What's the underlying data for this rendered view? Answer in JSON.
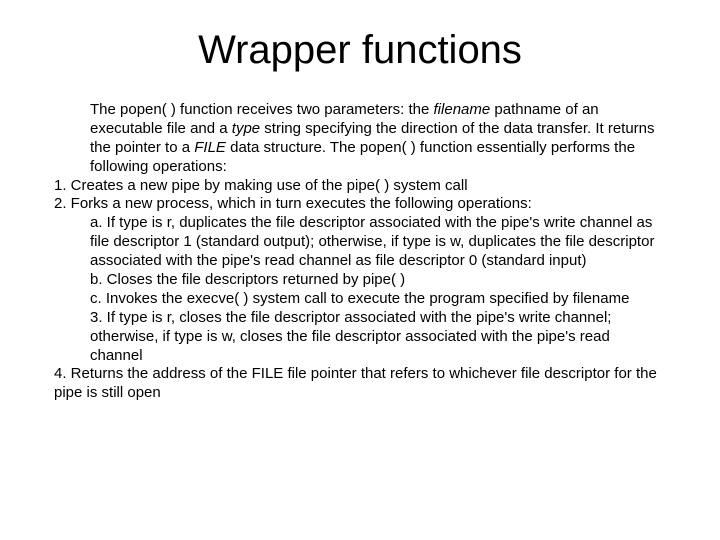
{
  "title": "Wrapper functions",
  "intro_a": "The popen( ) function receives two parameters: the ",
  "intro_b": "filename",
  "intro_c": " pathname of an executable file and a ",
  "intro_d": "type",
  "intro_e": " string specifying the direction of the data transfer. It returns the pointer to a ",
  "intro_f": "FILE",
  "intro_g": " data structure. The popen( ) function essentially performs the following operations:",
  "n1": "1. Creates a new pipe by making use of the pipe( ) system call",
  "n2": "2. Forks a new process, which in turn executes the following operations:",
  "s2a": "a. If type is r, duplicates the file descriptor associated with the pipe's write channel as file descriptor 1 (standard output); otherwise, if type is w, duplicates the file descriptor associated with the pipe's read channel as file descriptor 0 (standard input)",
  "s2b": "b. Closes the file descriptors returned by pipe( )",
  "s2c": "c. Invokes the execve( ) system call to execute the program specified by filename",
  "s3": "3. If type is r, closes the file descriptor associated with the pipe's write channel; otherwise, if type is w, closes the file descriptor associated with the pipe's read channel",
  "n4": "4. Returns the address of the FILE file pointer that refers to whichever file descriptor for the pipe is still open"
}
